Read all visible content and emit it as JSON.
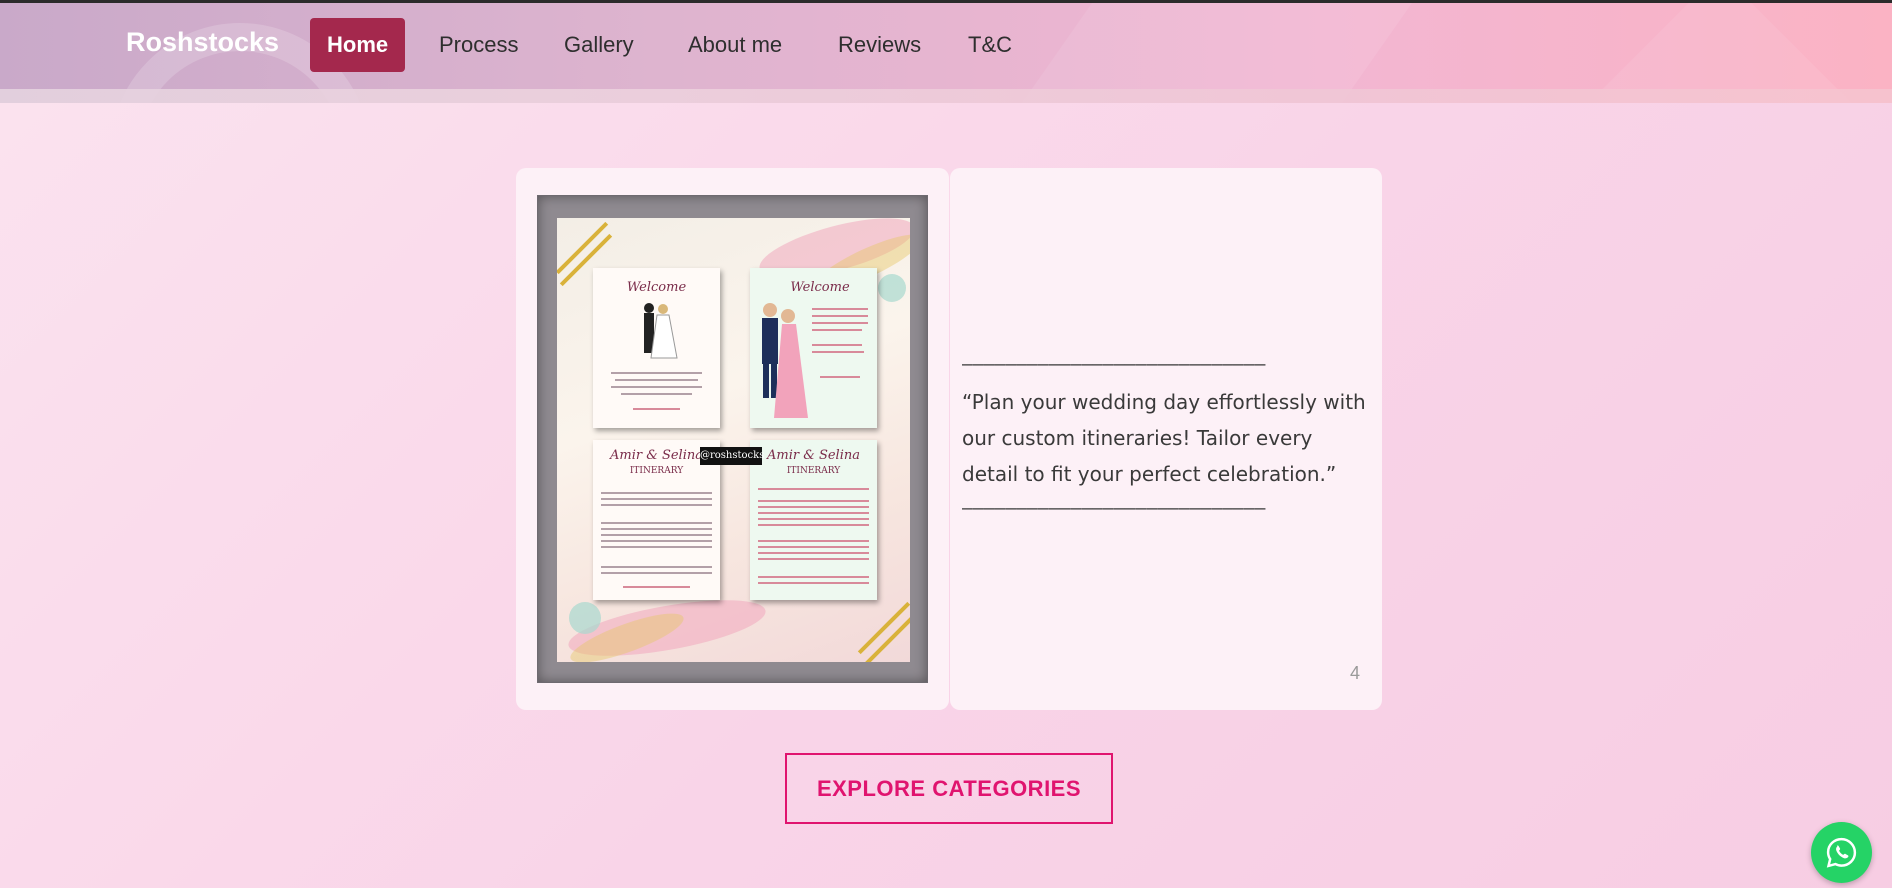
{
  "nav": {
    "brand": "Roshstocks",
    "items": [
      {
        "label": "Home",
        "active": true
      },
      {
        "label": "Process"
      },
      {
        "label": "Gallery"
      },
      {
        "label": "About me"
      },
      {
        "label": "Reviews"
      },
      {
        "label": "T&C"
      }
    ]
  },
  "slide": {
    "image_watermark": "@roshstocks",
    "poster": {
      "welcome": "Welcome",
      "itinerary_names": "Amir & Selina",
      "itinerary": "ITINERARY"
    },
    "rule": "————————————————————————————",
    "quote": "“Plan your wedding day effortlessly with our custom itineraries! Tailor every detail to fit your perfect celebration.”",
    "number": "4"
  },
  "cta": {
    "label": "EXPLORE CATEGORIES"
  },
  "colors": {
    "accent": "#e0146f",
    "active_nav": "#a4284d",
    "whatsapp": "#25d366"
  },
  "icons": {
    "chat": "whatsapp-icon"
  }
}
